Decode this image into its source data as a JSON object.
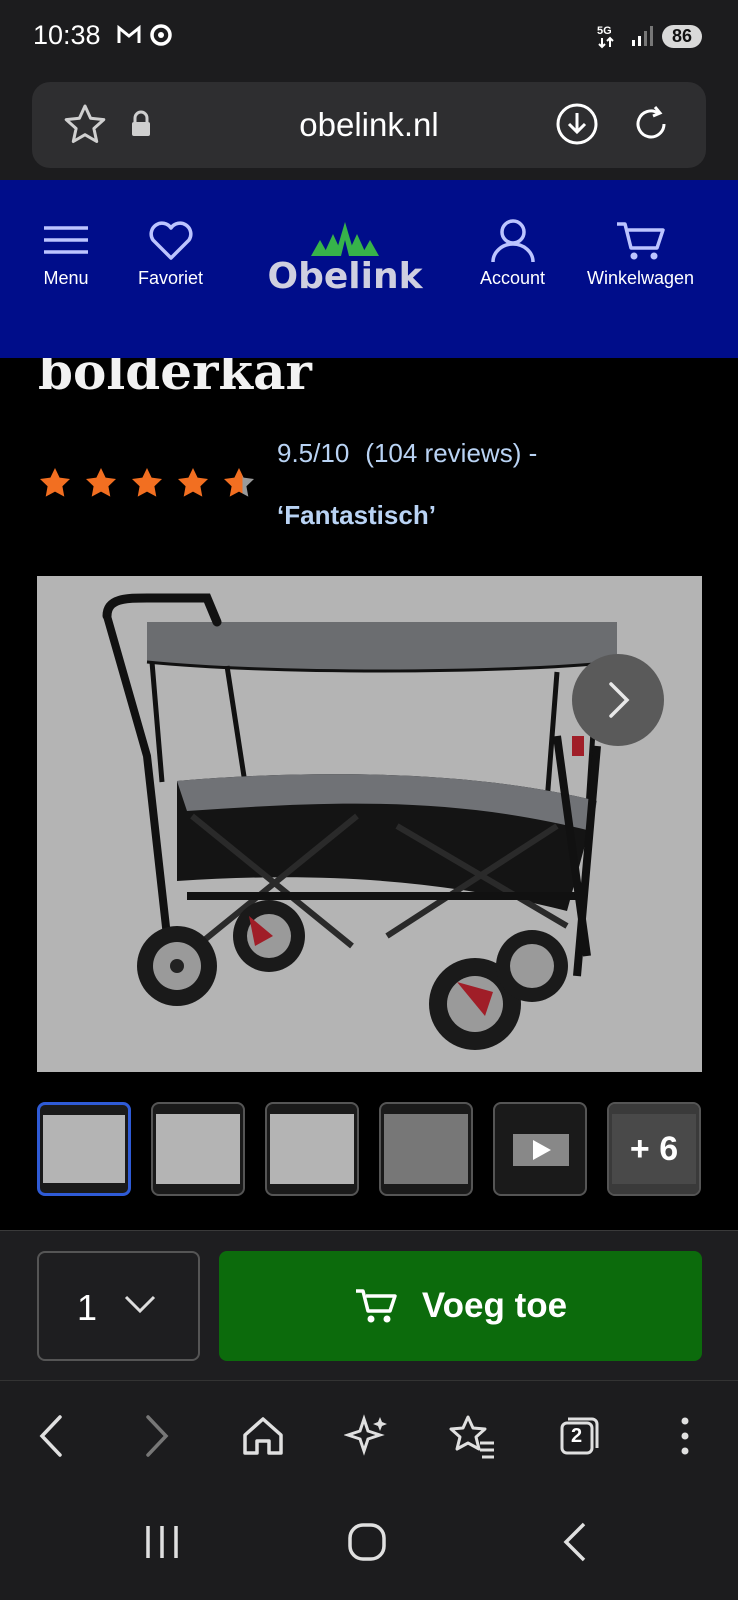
{
  "status": {
    "time": "10:38",
    "network": "5G",
    "battery": "86"
  },
  "urlbar": {
    "domain": "obelink.nl"
  },
  "header": {
    "menu_label": "Menu",
    "favorites_label": "Favoriet",
    "logo_text": "Obelink",
    "account_label": "Account",
    "cart_label": "Winkelwagen"
  },
  "product": {
    "title_fragment": "bolderkar",
    "rating_score": "9.5/10",
    "review_count": "(104 reviews) -",
    "rating_word": "‘Fantastisch’",
    "stars": 4.5,
    "more_images": "+ 6"
  },
  "buy": {
    "quantity": "1",
    "add_label": "Voeg toe"
  },
  "colors": {
    "header": "#000d8a",
    "add_button": "#0c6b0c",
    "star": "#f26f21",
    "link": "#b9d3f4"
  },
  "browser_toolbar": {
    "tabs_count": "2"
  }
}
